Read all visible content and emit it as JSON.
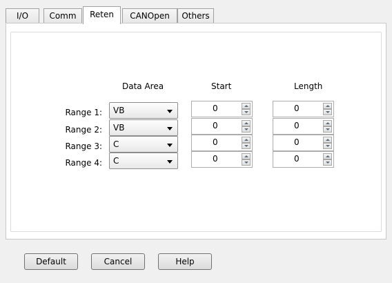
{
  "tabs": [
    "I/O",
    "Comm",
    "Reten",
    "CANOpen",
    "Others"
  ],
  "active_tab": "Reten",
  "headers": {
    "data_area": "Data Area",
    "start": "Start",
    "length": "Length"
  },
  "ranges": [
    {
      "label": "Range 1:",
      "area": "VB",
      "start": "0",
      "length": "0"
    },
    {
      "label": "Range 2:",
      "area": "VB",
      "start": "0",
      "length": "0"
    },
    {
      "label": "Range 3:",
      "area": "C",
      "start": "0",
      "length": "0"
    },
    {
      "label": "Range 4:",
      "area": "C",
      "start": "0",
      "length": "0"
    }
  ],
  "buttons": {
    "default": "Default",
    "cancel": "Cancel",
    "help": "Help"
  }
}
